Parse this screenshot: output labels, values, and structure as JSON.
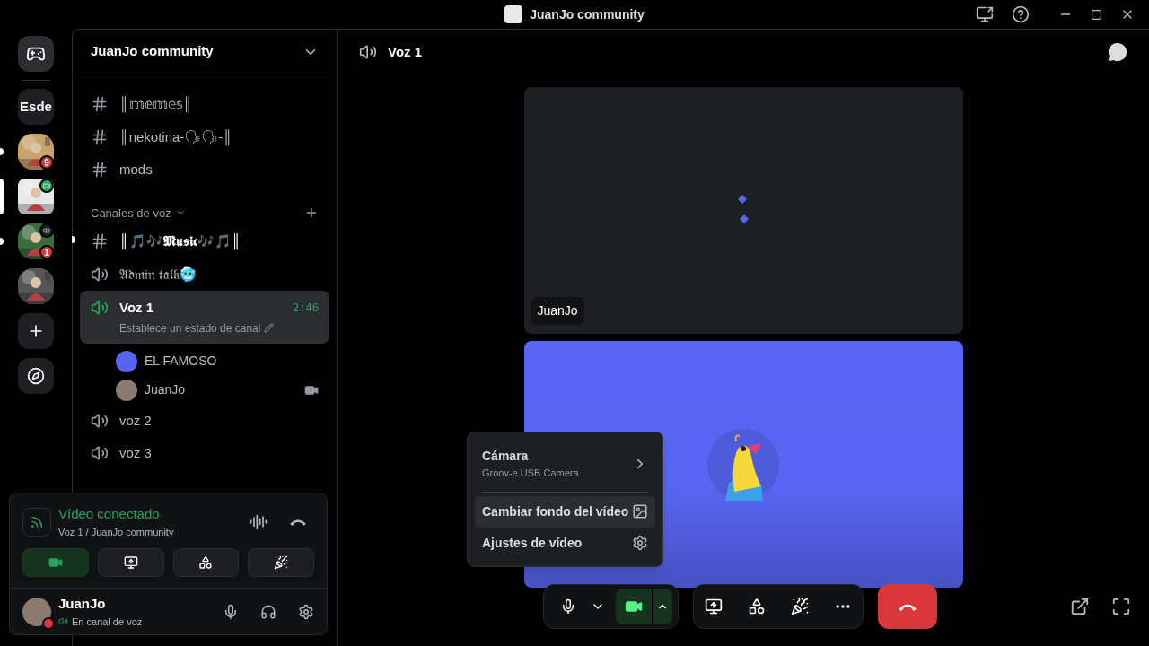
{
  "window": {
    "title": "JuanJo community"
  },
  "servers": [
    {
      "kind": "home"
    },
    {
      "kind": "text",
      "label": "Esde"
    },
    {
      "kind": "picture",
      "badge": "9",
      "unread": true,
      "selected": false,
      "color": "#c8a36a"
    },
    {
      "kind": "video",
      "unread": false,
      "selected": true,
      "color": "#e8e8e8"
    },
    {
      "kind": "voice",
      "badge": "1",
      "unread": true,
      "selected": false,
      "color": "#3a6b3a"
    },
    {
      "kind": "picture",
      "color": "#555555"
    },
    {
      "kind": "add"
    },
    {
      "kind": "explore"
    }
  ],
  "guild": {
    "name": "JuanJo community"
  },
  "channels": [
    {
      "kind": "text",
      "name": "║𝕞𝕖𝕞𝕖𝕤║",
      "unread": false
    },
    {
      "kind": "text",
      "name": "║nekotina-🗣🗣-║",
      "unread": false
    },
    {
      "kind": "text",
      "name": "mods",
      "unread": false
    },
    {
      "kind": "category",
      "name": "Canales de voz"
    },
    {
      "kind": "text",
      "name": "║🎵🎶𝕸𝖚𝖘𝖎𝖈🎶🎵║",
      "unread": true
    },
    {
      "kind": "voice",
      "name": "𝔄𝔡𝔪𝔦𝔫 𝔱𝔞𝔩𝔨🥶",
      "selected": false
    },
    {
      "kind": "voice",
      "name": "Voz 1",
      "selected": true,
      "time": "2:46",
      "status": "Establece un estado de canal",
      "members": [
        {
          "name": "EL FAMOSO",
          "video": false,
          "color": "#5865f2"
        },
        {
          "name": "JuanJo",
          "video": true,
          "color": "#8a7a70"
        }
      ]
    },
    {
      "kind": "voice",
      "name": "voz 2",
      "selected": false
    },
    {
      "kind": "voice",
      "name": "voz 3",
      "selected": false
    }
  ],
  "voice_panel": {
    "status": "Vídeo conectado",
    "location": "Voz 1 / JuanJo community",
    "buttons": [
      {
        "kind": "camera",
        "selected": true
      },
      {
        "kind": "screen",
        "selected": false
      },
      {
        "kind": "activities",
        "selected": false
      },
      {
        "kind": "soundboard",
        "selected": false
      }
    ]
  },
  "user": {
    "name": "JuanJo",
    "status": "En canal de voz"
  },
  "header": {
    "channel": "Voz 1"
  },
  "tiles": [
    {
      "kind": "video",
      "name": "JuanJo"
    },
    {
      "kind": "avatar"
    }
  ],
  "menu": [
    {
      "kind": "submenu",
      "label": "Cámara",
      "detail": "Groov-e USB Camera",
      "selected": false
    },
    {
      "kind": "background",
      "label": "Cambiar fondo del vídeo",
      "selected": true
    },
    {
      "kind": "settings",
      "label": "Ajustes de vídeo",
      "selected": false
    }
  ],
  "controls": {
    "camera_on": true
  }
}
